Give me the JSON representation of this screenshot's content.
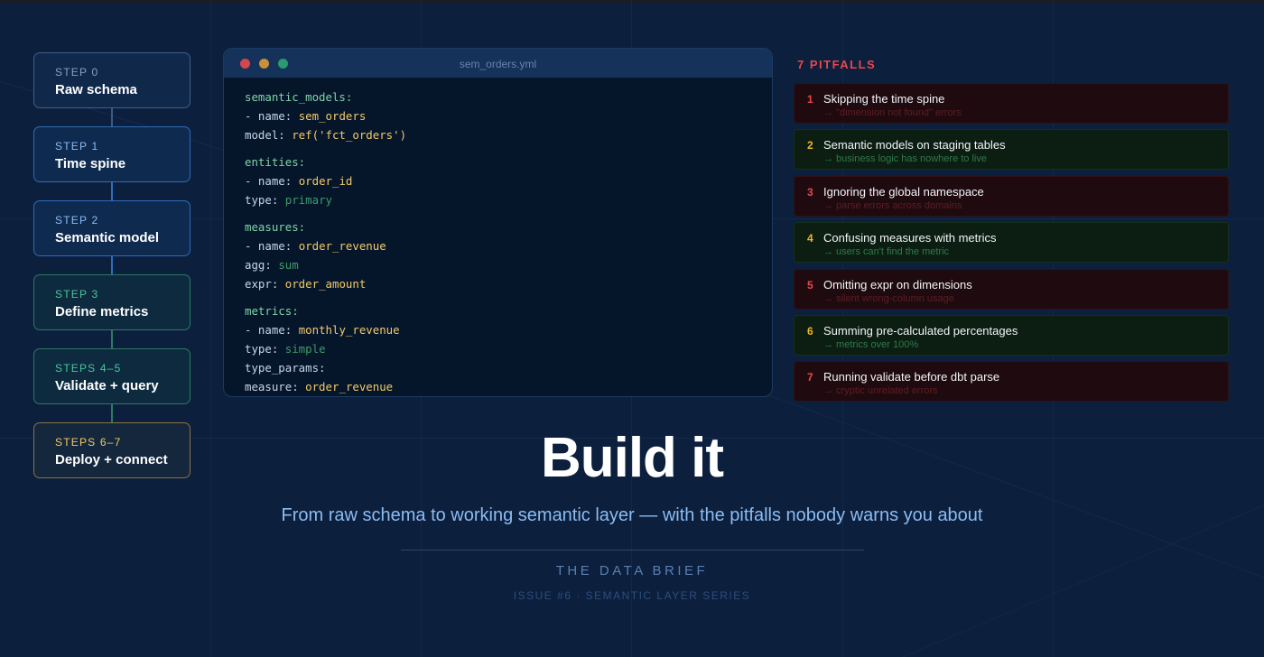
{
  "steps": [
    {
      "label": "STEP 0",
      "title": "Raw schema"
    },
    {
      "label": "STEP 1",
      "title": "Time spine"
    },
    {
      "label": "STEP 2",
      "title": "Semantic model"
    },
    {
      "label": "STEP 3",
      "title": "Define metrics"
    },
    {
      "label": "STEPS 4–5",
      "title": "Validate + query"
    },
    {
      "label": "STEPS 6–7",
      "title": "Deploy + connect"
    }
  ],
  "code_window": {
    "filename": "sem_orders.yml",
    "lines": {
      "l1": "semantic_models:",
      "l2_key": "- name: ",
      "l2_val": "sem_orders",
      "l3_key": "model: ",
      "l3_val": "ref('fct_orders')",
      "l4": "entities:",
      "l5_key": "- name: ",
      "l5_val": "order_id",
      "l6_key": "type: ",
      "l6_val": "primary",
      "l7": "measures:",
      "l8_key": "- name: ",
      "l8_val": "order_revenue",
      "l9_key": "agg: ",
      "l9_val": "sum",
      "l10_key": "expr: ",
      "l10_val": "order_amount",
      "l11": "metrics:",
      "l12_key": "- name: ",
      "l12_val": "monthly_revenue",
      "l13_key": "type: ",
      "l13_val": "simple",
      "l14": "type_params:",
      "l15_key": "measure: ",
      "l15_val": "order_revenue"
    }
  },
  "pitfalls": {
    "heading": "7 PITFALLS",
    "items": [
      {
        "num": "1",
        "title": "Skipping the time spine",
        "sub": "→ \"dimension not found\" errors"
      },
      {
        "num": "2",
        "title": "Semantic models on staging tables",
        "sub": "→ business logic has nowhere to live"
      },
      {
        "num": "3",
        "title": "Ignoring the global namespace",
        "sub": "→ parse errors across domains"
      },
      {
        "num": "4",
        "title": "Confusing measures with metrics",
        "sub": "→ users can't find the metric"
      },
      {
        "num": "5",
        "title": "Omitting expr on dimensions",
        "sub": "→ silent wrong-column usage"
      },
      {
        "num": "6",
        "title": "Summing pre-calculated percentages",
        "sub": "→ metrics over 100%"
      },
      {
        "num": "7",
        "title": "Running validate before dbt parse",
        "sub": "→ cryptic unrelated errors"
      }
    ]
  },
  "hero": {
    "title": "Build it",
    "subtitle": "From raw schema to working semantic layer — with the pitfalls nobody warns you about",
    "brand": "THE DATA BRIEF",
    "issue": "ISSUE #6 · SEMANTIC LAYER SERIES"
  },
  "colors": {
    "background": "#0c1f3d",
    "accent_blue": "#8cbcf2",
    "accent_teal": "#4cc59a",
    "accent_gold": "#f2c969",
    "pitfall_red": "#e5484d",
    "pitfall_amber": "#f0b429"
  }
}
